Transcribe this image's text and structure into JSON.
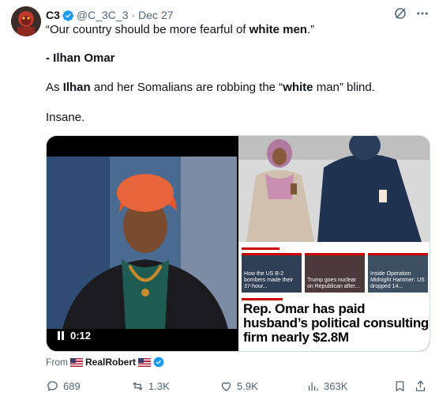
{
  "tweet": {
    "author_name": "C3",
    "handle": "@C_3C_3",
    "separator": "·",
    "date": "Dec 27",
    "lines": {
      "l1_pre": "“Our country should be more fearful of ",
      "l1_bold": "white men",
      "l1_post": ".”",
      "l2": "- Ilhan Omar",
      "l3_a": "As ",
      "l3_b": "Ilhan",
      "l3_c": " and her Somalians are robbing the “",
      "l3_d": "white",
      "l3_e": " man” blind.",
      "l4": "Insane."
    }
  },
  "media": {
    "video_time": "0:12",
    "article": {
      "thumbs": [
        {
          "text": "How the US B-2 bombers made their 37-hour..."
        },
        {
          "text": "Trump goes nuclear on Republican after..."
        },
        {
          "text": "Inside Operation Midnight Hammer: US dropped 14..."
        }
      ],
      "headline": "Rep. Omar has paid husband’s political consulting firm nearly $2.8M"
    }
  },
  "from": {
    "prefix": "From",
    "author": "RealRobert"
  },
  "actions": {
    "replies": "689",
    "reposts": "1.3K",
    "likes": "5.9K",
    "views": "363K"
  },
  "colors": {
    "accent": "#1d9bf0",
    "muted": "#536471",
    "text": "#0f1419",
    "news_red": "#cc0000"
  },
  "icons": [
    "verified-badge-icon",
    "grok-icon",
    "more-icon",
    "pause-icon",
    "reply-icon",
    "repost-icon",
    "like-icon",
    "views-icon",
    "bookmark-icon",
    "share-icon",
    "us-flag-icon"
  ]
}
